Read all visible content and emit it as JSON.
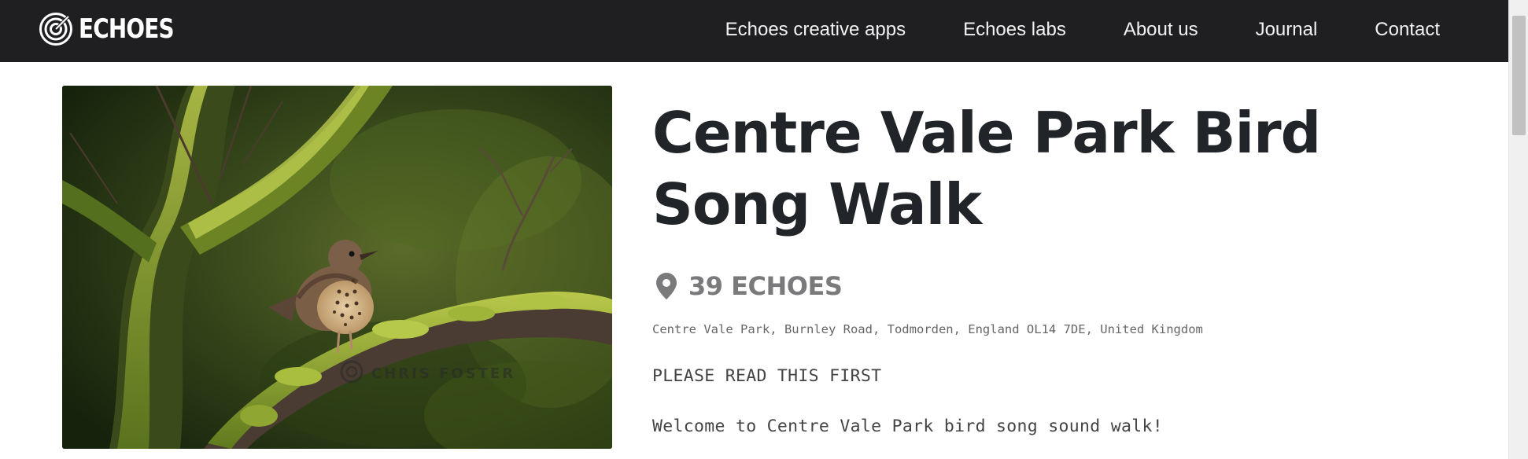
{
  "header": {
    "logo_text": "ECHOES",
    "nav": [
      {
        "label": "Echoes creative apps"
      },
      {
        "label": "Echoes labs"
      },
      {
        "label": "About us"
      },
      {
        "label": "Journal"
      },
      {
        "label": "Contact"
      }
    ]
  },
  "hero": {
    "watermark": "CHRIS FOSTER",
    "subject": "song thrush perched on mossy branch"
  },
  "walk": {
    "title": "Centre Vale Park Bird Song Walk",
    "echoes_count": "39 ECHOES",
    "address": "Centre Vale Park, Burnley Road, Todmorden, England OL14 7DE, United Kingdom",
    "notice": "PLEASE READ THIS FIRST",
    "welcome": "Welcome to Centre Vale Park bird song sound walk!"
  },
  "icons": {
    "logo": "concentric-rings-logo-icon",
    "location": "map-pin-icon"
  },
  "colors": {
    "header_bg": "#1f1e21",
    "title": "#212529",
    "count": "#7a7a7c",
    "body_text": "#444444"
  }
}
